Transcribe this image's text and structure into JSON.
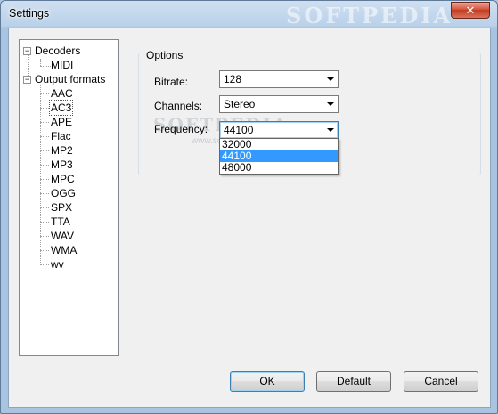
{
  "window": {
    "title": "Settings",
    "close_symbol": "✕",
    "watermark": "SOFTPEDIA"
  },
  "tree": {
    "groups": [
      {
        "label": "Decoders",
        "expander": "−",
        "children": [
          "MIDI"
        ]
      },
      {
        "label": "Output formats",
        "expander": "−",
        "children": [
          "AAC",
          "AC3",
          "APE",
          "Flac",
          "MP2",
          "MP3",
          "MPC",
          "OGG",
          "SPX",
          "TTA",
          "WAV",
          "WMA",
          "wv"
        ]
      }
    ],
    "selected": "AC3"
  },
  "options": {
    "legend": "Options",
    "bitrate": {
      "label": "Bitrate:",
      "value": "128"
    },
    "channels": {
      "label": "Channels:",
      "value": "Stereo"
    },
    "frequency": {
      "label": "Frequency:",
      "value": "44100",
      "options": [
        "32000",
        "44100",
        "48000"
      ],
      "highlighted": "44100"
    },
    "watermark": "SOFTPEDIA",
    "watermark_sub": "www.softpedia.com"
  },
  "buttons": {
    "ok": "OK",
    "default": "Default",
    "cancel": "Cancel"
  },
  "colors": {
    "selection": "#3399ff",
    "focus_border": "#3c7fb1"
  }
}
